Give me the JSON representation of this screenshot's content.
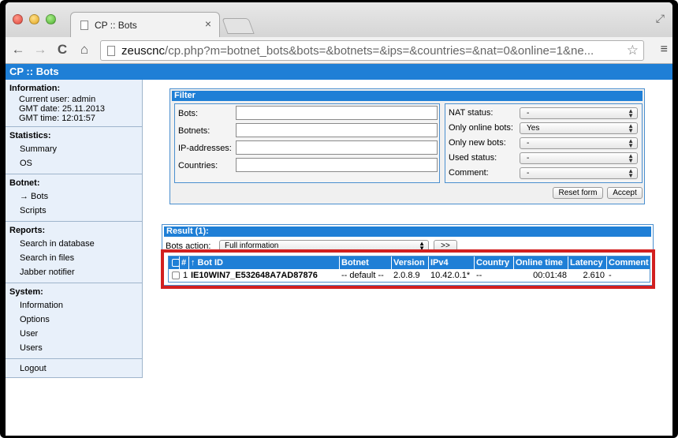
{
  "browser": {
    "tab_title": "CP :: Bots",
    "tab_close": "×",
    "url_host": "zeuscnc",
    "url_path": "/cp.php?m=botnet_bots&bots=&botnets=&ips=&countries=&nat=0&online=1&ne...",
    "back": "←",
    "forward": "→",
    "reload": "C",
    "home": "⌂",
    "star": "☆",
    "menu": "≡",
    "resize": "⤢"
  },
  "header": {
    "title": "CP :: Bots"
  },
  "sidebar": {
    "information": {
      "heading": "Information:",
      "user": "Current user: admin",
      "gmt_date": "GMT date:  25.11.2013",
      "gmt_time": "GMT time:  12:01:57"
    },
    "statistics": {
      "heading": "Statistics:",
      "items": [
        "Summary",
        "OS"
      ]
    },
    "botnet": {
      "heading": "Botnet:",
      "items": [
        "→ Bots",
        "Scripts"
      ]
    },
    "reports": {
      "heading": "Reports:",
      "items": [
        "Search in database",
        "Search in files",
        "Jabber notifier"
      ]
    },
    "system": {
      "heading": "System:",
      "items": [
        "Information",
        "Options",
        "User",
        "Users"
      ]
    },
    "logout": "Logout"
  },
  "filter": {
    "title": "Filter",
    "fields": [
      "Bots:",
      "Botnets:",
      "IP-addresses:",
      "Countries:"
    ],
    "selects": [
      {
        "label": "NAT status:",
        "value": "-"
      },
      {
        "label": "Only online bots:",
        "value": "Yes"
      },
      {
        "label": "Only new bots:",
        "value": "-"
      },
      {
        "label": "Used status:",
        "value": "-"
      },
      {
        "label": "Comment:",
        "value": "-"
      }
    ],
    "reset_label": "Reset form",
    "accept_label": "Accept"
  },
  "result": {
    "title": "Result (1):",
    "bots_action_label": "Bots action:",
    "action_value": "Full information",
    "go_label": ">>",
    "columns": [
      "",
      "#",
      "↑ Bot ID",
      "Botnet",
      "Version",
      "IPv4",
      "Country",
      "Online time",
      "Latency",
      "Comment"
    ],
    "rows": [
      {
        "num": "1",
        "bot_id": "IE10WIN7_E532648A7AD87876",
        "botnet": "-- default --",
        "version": "2.0.8.9",
        "ipv4": "10.42.0.1*",
        "country": "--",
        "online_time": "00:01:48",
        "latency": "2.610",
        "comment": "-"
      }
    ]
  },
  "colors": {
    "accent": "#1f7fd6",
    "highlight": "#d22020"
  }
}
